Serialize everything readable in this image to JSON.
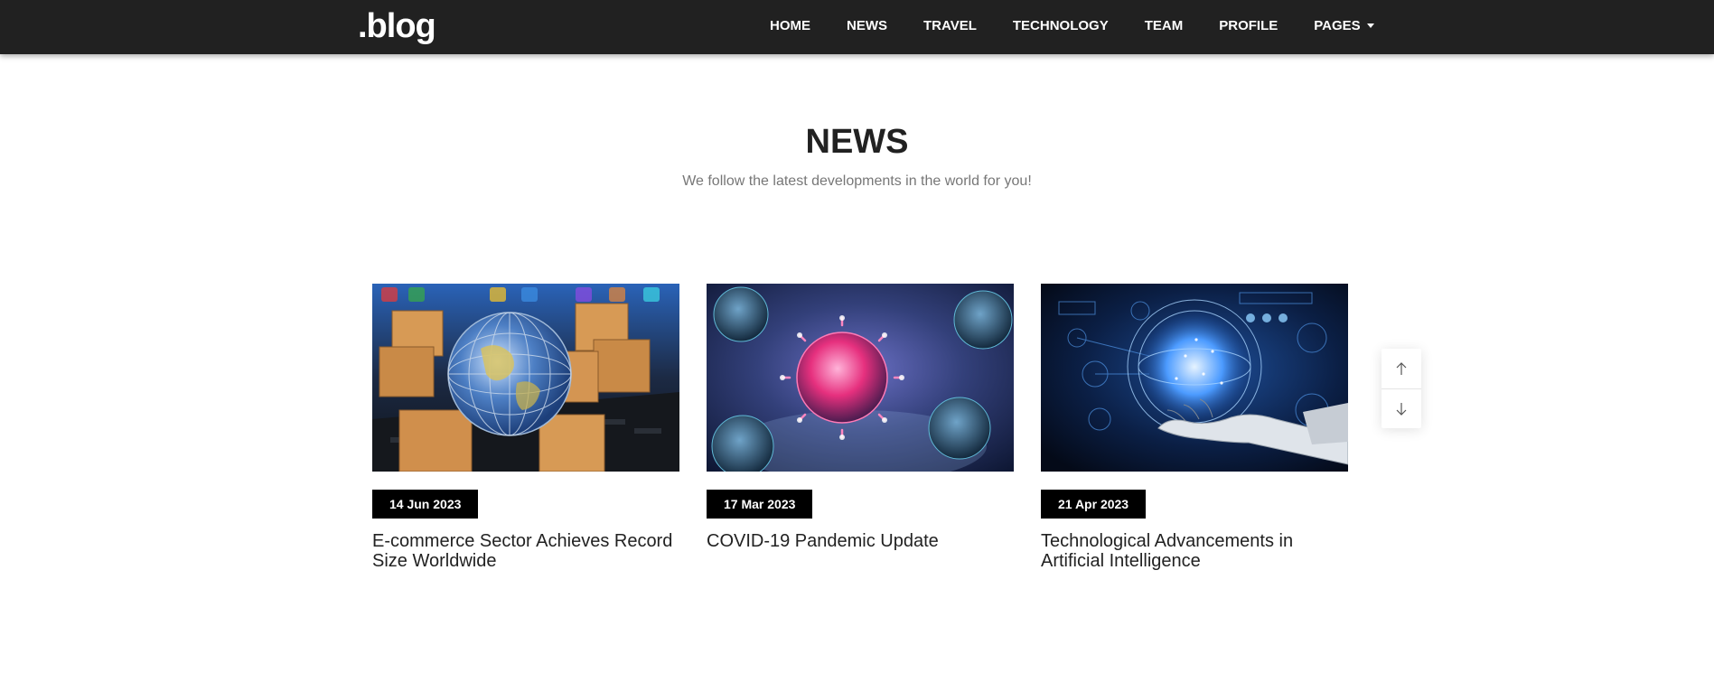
{
  "brand": {
    "logo": ".blog"
  },
  "nav": {
    "items": [
      {
        "label": "HOME"
      },
      {
        "label": "NEWS"
      },
      {
        "label": "TRAVEL"
      },
      {
        "label": "TECHNOLOGY"
      },
      {
        "label": "TEAM"
      },
      {
        "label": "PROFILE"
      },
      {
        "label": "PAGES"
      }
    ]
  },
  "section": {
    "title": "NEWS",
    "subtitle": "We follow the latest developments in the world for you!"
  },
  "articles": [
    {
      "date": "14 Jun 2023",
      "title": "E-commerce Sector Achieves Record Size Worldwide",
      "image_icon": "globe-shipping-boxes"
    },
    {
      "date": "17 Mar 2023",
      "title": "COVID-19 Pandemic Update",
      "image_icon": "virus-particles"
    },
    {
      "date": "21 Apr 2023",
      "title": "Technological Advancements in Artificial Intelligence",
      "image_icon": "robot-hand-ai"
    }
  ],
  "scroll": {
    "up_icon": "arrow-up-icon",
    "down_icon": "arrow-down-icon"
  },
  "colors": {
    "navbar": "#212121",
    "badge": "#000000",
    "text": "#222222",
    "subtitle": "#777777"
  }
}
